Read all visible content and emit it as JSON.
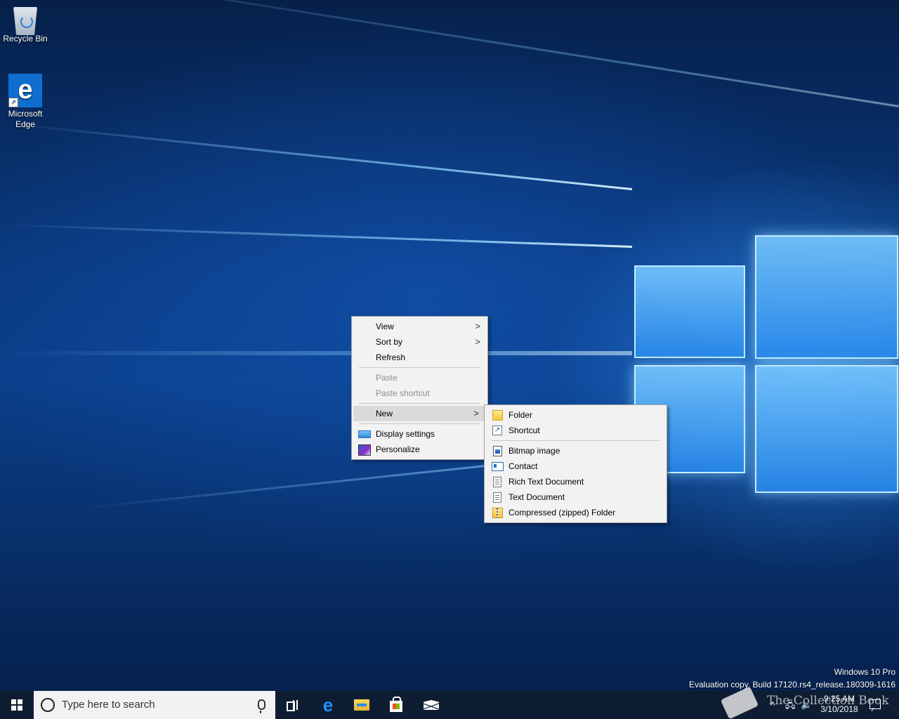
{
  "desktop": {
    "icons": [
      {
        "label": "Recycle Bin",
        "icon": "recycle-bin-icon"
      },
      {
        "label": "Microsoft\nEdge",
        "label_line1": "Microsoft",
        "label_line2": "Edge",
        "icon": "edge-icon"
      }
    ]
  },
  "context_menu": {
    "items": [
      {
        "label": "View",
        "submenu": true
      },
      {
        "label": "Sort by",
        "submenu": true
      },
      {
        "label": "Refresh"
      },
      {
        "label": "Paste",
        "disabled": true
      },
      {
        "label": "Paste shortcut",
        "disabled": true
      },
      {
        "label": "New",
        "submenu": true,
        "highlighted": true
      },
      {
        "label": "Display settings",
        "icon": "display-icon"
      },
      {
        "label": "Personalize",
        "icon": "personalize-icon"
      }
    ]
  },
  "new_submenu": {
    "items": [
      {
        "label": "Folder",
        "icon": "folder-icon"
      },
      {
        "label": "Shortcut",
        "icon": "shortcut-icon"
      },
      {
        "label": "Bitmap image",
        "icon": "bitmap-icon"
      },
      {
        "label": "Contact",
        "icon": "contact-icon"
      },
      {
        "label": "Rich Text Document",
        "icon": "rich-text-icon"
      },
      {
        "label": "Text Document",
        "icon": "text-document-icon"
      },
      {
        "label": "Compressed (zipped) Folder",
        "icon": "zip-folder-icon"
      }
    ]
  },
  "watermark": {
    "line1": "Windows 10 Pro",
    "line2": "Evaluation copy. Build 17120.rs4_release.180309-1616"
  },
  "taskbar": {
    "search_placeholder": "Type here to search",
    "pinned": [
      "task-view-icon",
      "edge-icon",
      "file-explorer-icon",
      "store-icon",
      "mail-icon"
    ],
    "tray": {
      "chevron": "^",
      "clock_time": "9:25 AM",
      "clock_date": "3/10/2018"
    }
  },
  "overlay": {
    "brand_text": "The Collection Book"
  }
}
